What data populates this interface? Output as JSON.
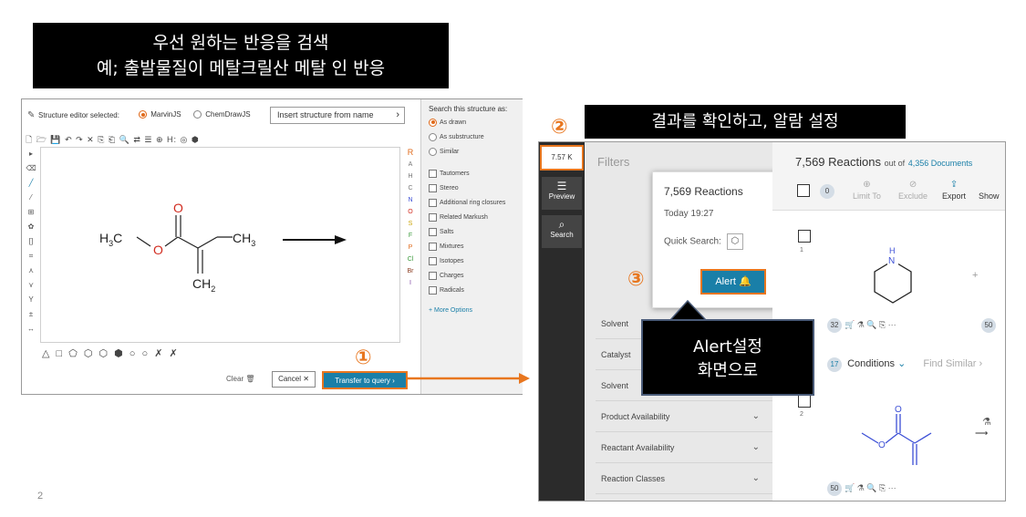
{
  "banners": {
    "step1_line1": "우선 원하는 반응을 검색",
    "step1_line2": "예; 출발물질이 메탈크릴산 메탈 인 반응",
    "step2": "결과를 확인하고, 알람 설정",
    "step3_line1": "Alert설정",
    "step3_line2": "화면으로"
  },
  "step_badges": {
    "one": "①",
    "two": "②",
    "three": "③"
  },
  "editor": {
    "label": "Structure editor selected:",
    "options": [
      "MarvinJS",
      "ChemDrawJS"
    ],
    "selected": "MarvinJS",
    "insert_button": "Insert structure from name",
    "toolbar_glyphs": "🗋 🗁 💾 ↶ ↷ ✕ ⎘ ⎗ 🔍 ⇄ ☰ ⊕ H: ◎ ⬢",
    "left_tools": [
      "▸",
      "⌫",
      "╱",
      "⁄",
      "⊞",
      "✿",
      "[]",
      "⌗",
      "⋏",
      "⋎",
      "Y",
      "±",
      "↔"
    ],
    "right_tools": [
      "R",
      "A",
      "H",
      "C",
      "N",
      "O",
      "S",
      "F",
      "P",
      "Cl",
      "Br",
      "I"
    ],
    "shapes": "△ □ ⬠ ⬡ ⬡ ⬢ ○ ○ ✗ ✗",
    "molecule": {
      "atoms": [
        "H3C",
        "O",
        "O",
        "CH3",
        "CH2"
      ],
      "left_methyl": "H",
      "left_methyl_sub": "3",
      "left_methyl_tail": "C",
      "right_methyl": "CH",
      "right_methyl_sub": "3",
      "bottom": "CH",
      "bottom_sub": "2",
      "oxygen": "O",
      "carbonyl_oxygen": "O"
    },
    "clear_label": "Clear 🗑",
    "cancel_label": "Cancel ✕",
    "transfer_label": "Transfer to query ›"
  },
  "search_options": {
    "title": "Search this structure as:",
    "radios": [
      "As drawn",
      "As substructure",
      "Similar"
    ],
    "selected": "As drawn",
    "checkboxes": [
      "Tautomers",
      "Stereo",
      "Additional ring closures",
      "Related Markush",
      "Salts",
      "Mixtures",
      "Isotopes",
      "Charges",
      "Radicals"
    ],
    "more": "+ More Options"
  },
  "results_panel": {
    "count_chip": "7.57 K",
    "nav": [
      {
        "icon": "☰",
        "label": "Preview"
      },
      {
        "icon": "⌕",
        "label": "Search"
      }
    ],
    "filters_title": "Filters",
    "filter_rows": [
      "Solvent",
      "Catalyst",
      "Solvent",
      "Product Availability",
      "Reactant Availability",
      "Reaction Classes"
    ],
    "popup": {
      "title": "7,569 Reactions",
      "time": "Today 19:27",
      "quick_search": "Quick Search:",
      "alert_button": "Alert 🔔"
    },
    "header": {
      "count": "7,569 Reactions",
      "out_of": "out of",
      "documents": "4,356 Documents"
    },
    "selected_count": "0",
    "actions": [
      {
        "icon": "⊕",
        "label": "Limit To"
      },
      {
        "icon": "⊘",
        "label": "Exclude"
      },
      {
        "icon": "⇪",
        "label": "Export"
      },
      {
        "icon": "",
        "label": "Show"
      }
    ],
    "rows": [
      {
        "num": "1",
        "amine": "H",
        "amine_n": "N"
      },
      {
        "num": "2"
      }
    ],
    "stat_bar_1": {
      "count": "32",
      "icons": "🛒 ⚗ 🔍 ⎘ ⋯",
      "right": "50"
    },
    "stat_bar_2": {
      "count": "50",
      "icons": "🛒 ⚗ 🔍 ⎘ ⋯"
    },
    "conditions": {
      "count": "17",
      "label": "Conditions",
      "find_similar": "Find Similar ›"
    }
  },
  "page_number": "2",
  "colors": {
    "accent_orange": "#e8761e",
    "primary_blue": "#1a7fa8",
    "molecule_red": "#d12b1f",
    "molecule_blue": "#3c4fd6"
  }
}
